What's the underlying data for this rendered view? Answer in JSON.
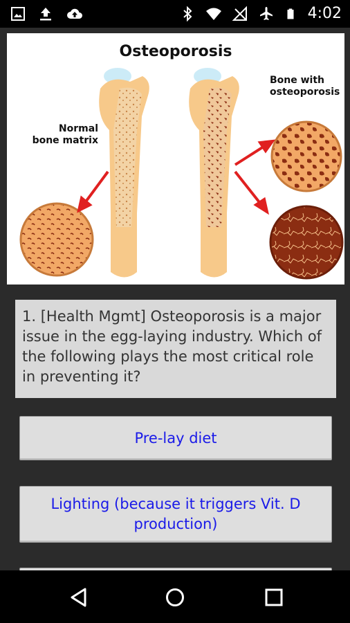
{
  "status_bar": {
    "time": "4:02",
    "icons": [
      "image-icon",
      "upload-icon",
      "cloud-upload-icon",
      "bluetooth-icon",
      "wifi-icon",
      "no-signal-icon",
      "airplane-icon",
      "battery-icon"
    ]
  },
  "figure": {
    "title": "Osteoporosis",
    "label_left": "Normal bone matrix",
    "label_right": "Bone with osteoporosis",
    "colors": {
      "bone": "#f7c98a",
      "porous": "#c0392b",
      "arrow": "#e02020",
      "dark_bone": "#8b2d12"
    }
  },
  "question": {
    "text": "1. [Health Mgmt] Osteoporosis is a major issue in the egg-laying industry. Which of the following plays the most critical role in preventing it?"
  },
  "answers": [
    {
      "label": "Pre-lay diet"
    },
    {
      "label": "Lighting (because it triggers Vit. D production)"
    },
    {
      "label": ""
    }
  ],
  "nav": {
    "icons": [
      "back-icon",
      "home-icon",
      "recents-icon"
    ]
  }
}
